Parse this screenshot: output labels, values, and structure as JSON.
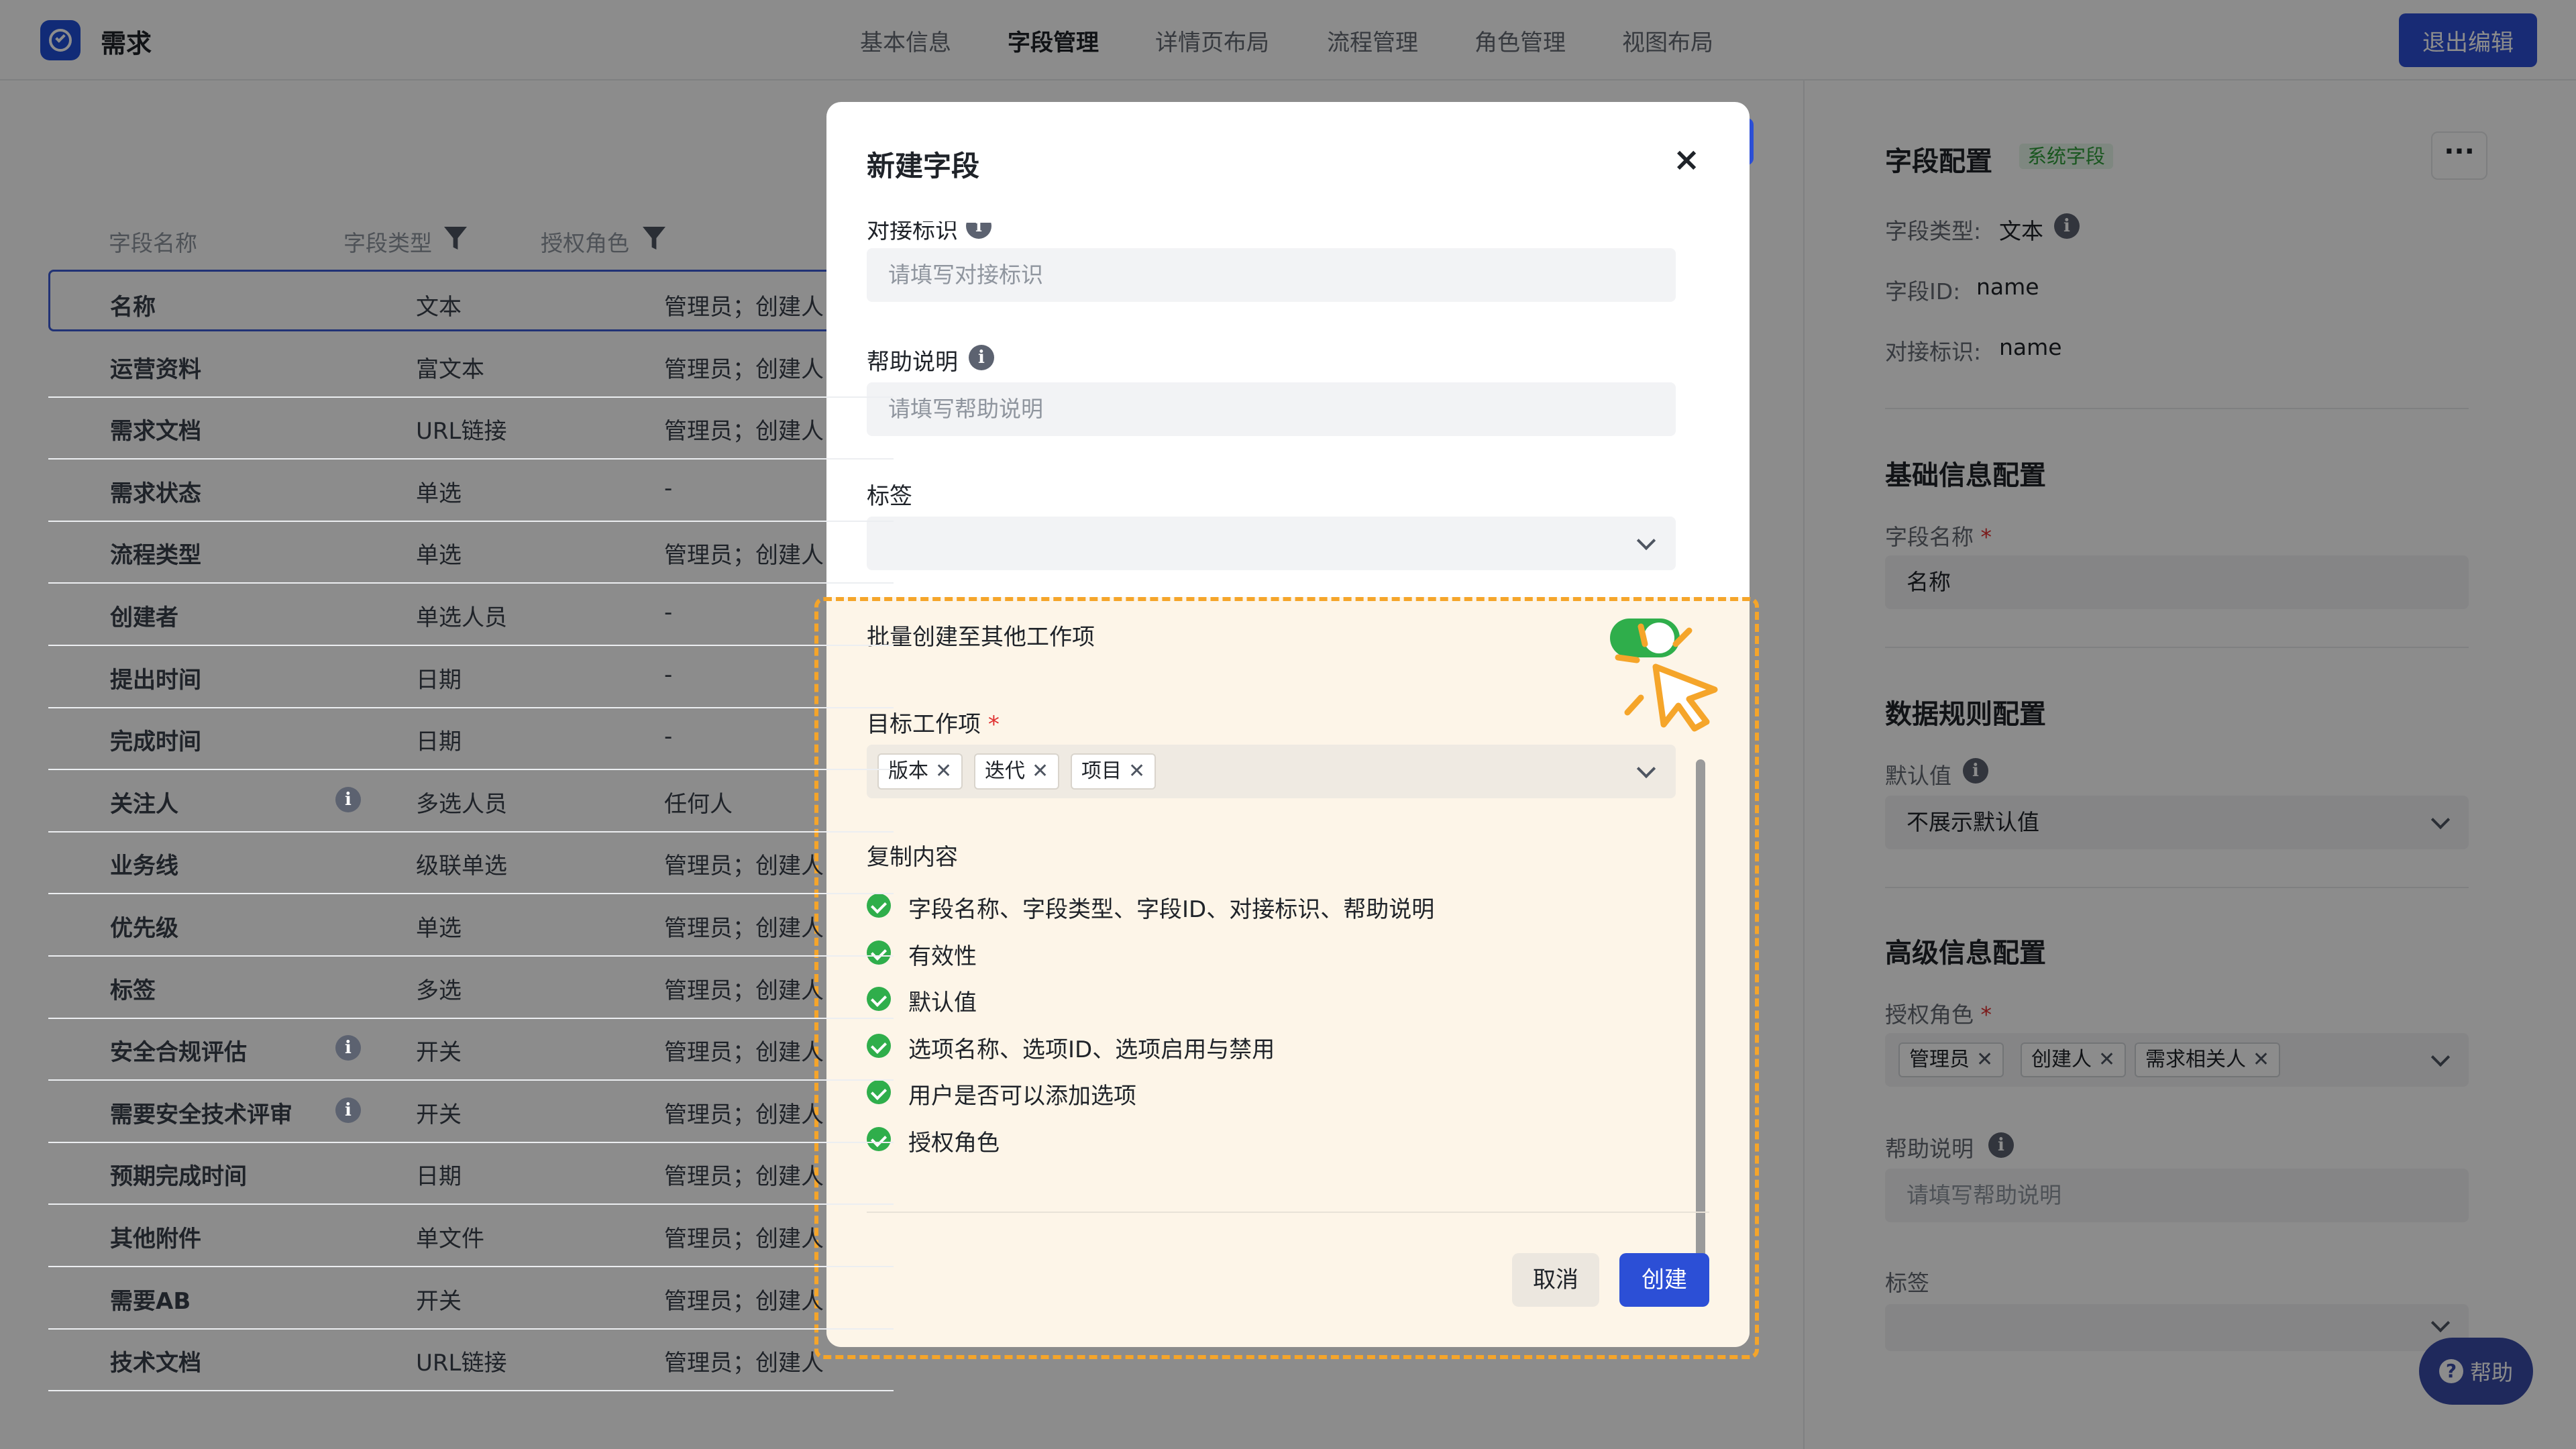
{
  "app": {
    "title": "需求",
    "exit_label": "退出编辑"
  },
  "nav": {
    "tabs": [
      "基本信息",
      "字段管理",
      "详情页布局",
      "流程管理",
      "角色管理",
      "视图布局"
    ],
    "active": "字段管理"
  },
  "table": {
    "headers": {
      "name": "字段名称",
      "type": "字段类型",
      "role": "授权角色"
    },
    "rows": [
      {
        "name": "名称",
        "type": "文本",
        "role": "管理员；创建人",
        "info": false
      },
      {
        "name": "运营资料",
        "type": "富文本",
        "role": "管理员；创建人",
        "info": false
      },
      {
        "name": "需求文档",
        "type": "URL链接",
        "role": "管理员；创建人",
        "info": false
      },
      {
        "name": "需求状态",
        "type": "单选",
        "role": "-",
        "info": false
      },
      {
        "name": "流程类型",
        "type": "单选",
        "role": "管理员；创建人",
        "info": false
      },
      {
        "name": "创建者",
        "type": "单选人员",
        "role": "-",
        "info": false
      },
      {
        "name": "提出时间",
        "type": "日期",
        "role": "-",
        "info": false
      },
      {
        "name": "完成时间",
        "type": "日期",
        "role": "-",
        "info": false
      },
      {
        "name": "关注人",
        "type": "多选人员",
        "role": "任何人",
        "info": true
      },
      {
        "name": "业务线",
        "type": "级联单选",
        "role": "管理员；创建人",
        "info": false
      },
      {
        "name": "优先级",
        "type": "单选",
        "role": "管理员；创建人",
        "info": false
      },
      {
        "name": "标签",
        "type": "多选",
        "role": "管理员；创建人",
        "info": false
      },
      {
        "name": "安全合规评估",
        "type": "开关",
        "role": "管理员；创建人",
        "info": true
      },
      {
        "name": "需要安全技术评审",
        "type": "开关",
        "role": "管理员；创建人",
        "info": true
      },
      {
        "name": "预期完成时间",
        "type": "日期",
        "role": "管理员；创建人",
        "info": false
      },
      {
        "name": "其他附件",
        "type": "单文件",
        "role": "管理员；创建人",
        "info": false
      },
      {
        "name": "需要AB",
        "type": "开关",
        "role": "管理员；创建人",
        "info": false
      },
      {
        "name": "技术文档",
        "type": "URL链接",
        "role": "管理员；创建人",
        "info": false
      }
    ]
  },
  "config": {
    "title": "字段配置",
    "badge": "系统字段",
    "more": "···",
    "type_label": "字段类型:",
    "type_value": "文本",
    "id_label": "字段ID:",
    "id_value": "name",
    "key_label": "对接标识:",
    "key_value": "name",
    "basic_title": "基础信息配置",
    "name_label": "字段名称",
    "name_value": "名称",
    "rule_title": "数据规则配置",
    "default_label": "默认值",
    "default_value": "不展示默认值",
    "adv_title": "高级信息配置",
    "roles_label": "授权角色",
    "roles": [
      "管理员",
      "创建人",
      "需求相关人"
    ],
    "help_label": "帮助说明",
    "help_placeholder": "请填写帮助说明",
    "tag_label": "标签",
    "required_mark": "*"
  },
  "help_button": {
    "label": "帮助",
    "icon": "?"
  },
  "modal": {
    "title": "新建字段",
    "close_icon": "×",
    "key_label": "对接标识",
    "key_placeholder": "请填写对接标识",
    "help_label": "帮助说明",
    "help_placeholder": "请填写帮助说明",
    "tag_label": "标签",
    "batch_label": "批量创建至其他工作项",
    "batch_enabled": true,
    "target_label": "目标工作项",
    "required_mark": "*",
    "targets": [
      "版本",
      "迭代",
      "项目"
    ],
    "copy_title": "复制内容",
    "copy_items": [
      "字段名称、字段类型、字段ID、对接标识、帮助说明",
      "有效性",
      "默认值",
      "选项名称、选项ID、选项启用与禁用",
      "用户是否可以添加选项",
      "授权角色"
    ],
    "cancel_label": "取消",
    "create_label": "创建"
  },
  "colors": {
    "accent": "#2c4fd6",
    "success": "#2fae4b",
    "highlight": "#f5a52a"
  }
}
